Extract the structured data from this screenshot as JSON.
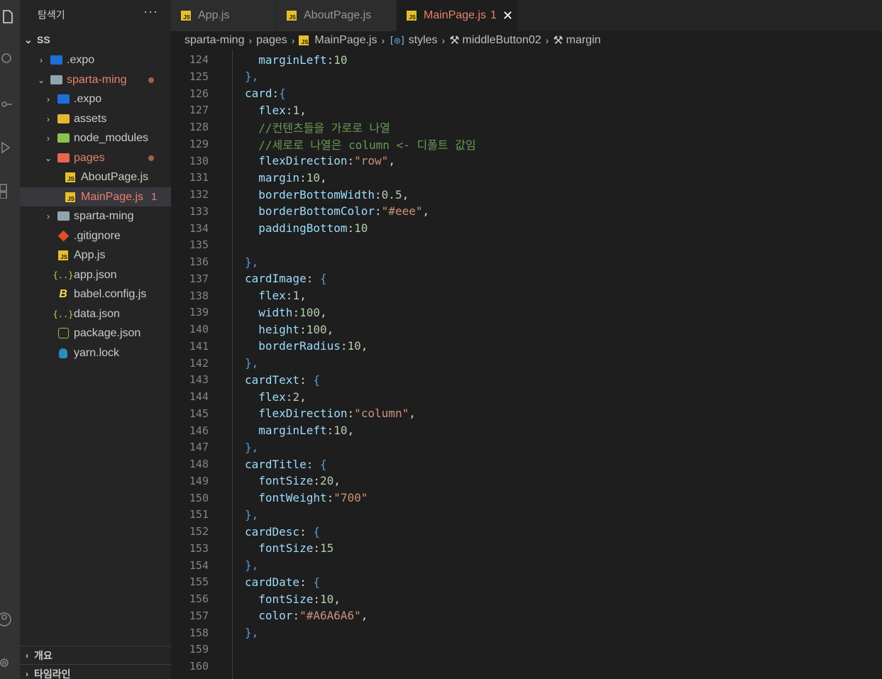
{
  "sidebar": {
    "title": "탐색기",
    "more": "···",
    "root": "SS",
    "items": [
      {
        "label": ".expo",
        "icon": "expo-folder-icon",
        "chev": "›",
        "modified": false
      },
      {
        "label": "sparta-ming",
        "icon": "open-folder-icon",
        "chev": "⌄",
        "modified": true
      },
      {
        "label": ".expo",
        "icon": "expo-folder-icon",
        "chev": "›",
        "modified": false
      },
      {
        "label": "assets",
        "icon": "assets-folder-icon",
        "chev": "›",
        "modified": false
      },
      {
        "label": "node_modules",
        "icon": "node-folder-icon",
        "chev": "›",
        "modified": false
      },
      {
        "label": "pages",
        "icon": "pages-folder-icon",
        "chev": "⌄",
        "modified": true
      },
      {
        "label": "AboutPage.js",
        "icon": "js-file-icon",
        "chev": "",
        "modified": false
      },
      {
        "label": "MainPage.js",
        "icon": "js-file-icon",
        "chev": "",
        "modified": true,
        "badge": "1"
      },
      {
        "label": "sparta-ming",
        "icon": "folder-icon",
        "chev": "›",
        "modified": false
      },
      {
        "label": ".gitignore",
        "icon": "git-icon",
        "chev": "",
        "modified": false
      },
      {
        "label": "App.js",
        "icon": "js-file-icon",
        "chev": "",
        "modified": false
      },
      {
        "label": "app.json",
        "icon": "json-file-icon",
        "chev": "",
        "modified": false
      },
      {
        "label": "babel.config.js",
        "icon": "babel-icon",
        "chev": "",
        "modified": false
      },
      {
        "label": "data.json",
        "icon": "json-file-icon",
        "chev": "",
        "modified": false
      },
      {
        "label": "package.json",
        "icon": "npm-icon",
        "chev": "",
        "modified": false
      },
      {
        "label": "yarn.lock",
        "icon": "yarn-icon",
        "chev": "",
        "modified": false
      }
    ],
    "sections": [
      "개요",
      "타임라인"
    ]
  },
  "tabs": [
    {
      "label": "App.js",
      "active": false
    },
    {
      "label": "AboutPage.js",
      "active": false
    },
    {
      "label": "MainPage.js",
      "active": true,
      "badge": "1",
      "close": "✕"
    }
  ],
  "breadcrumb": [
    "sparta-ming",
    "pages",
    "MainPage.js",
    "styles",
    "middleButton02",
    "margin"
  ],
  "editor": {
    "lines": [
      {
        "n": "124",
        "code": "  marginLeft:10"
      },
      {
        "n": "125",
        "code": "},"
      },
      {
        "n": "126",
        "code": "card:{"
      },
      {
        "n": "127",
        "code": "  flex:1,"
      },
      {
        "n": "128",
        "code": "  //컨텐츠들을 가로로 나열"
      },
      {
        "n": "129",
        "code": "  //세로로 나열은 column <- 디폴트 값임"
      },
      {
        "n": "130",
        "code": "  flexDirection:\"row\","
      },
      {
        "n": "131",
        "code": "  margin:10,"
      },
      {
        "n": "132",
        "code": "  borderBottomWidth:0.5,"
      },
      {
        "n": "133",
        "code": "  borderBottomColor:\"#eee\","
      },
      {
        "n": "134",
        "code": "  paddingBottom:10"
      },
      {
        "n": "135",
        "code": ""
      },
      {
        "n": "136",
        "code": "},"
      },
      {
        "n": "137",
        "code": "cardImage: {"
      },
      {
        "n": "138",
        "code": "  flex:1,"
      },
      {
        "n": "139",
        "code": "  width:100,"
      },
      {
        "n": "140",
        "code": "  height:100,"
      },
      {
        "n": "141",
        "code": "  borderRadius:10,"
      },
      {
        "n": "142",
        "code": "},"
      },
      {
        "n": "143",
        "code": "cardText: {"
      },
      {
        "n": "144",
        "code": "  flex:2,"
      },
      {
        "n": "145",
        "code": "  flexDirection:\"column\","
      },
      {
        "n": "146",
        "code": "  marginLeft:10,"
      },
      {
        "n": "147",
        "code": "},"
      },
      {
        "n": "148",
        "code": "cardTitle: {"
      },
      {
        "n": "149",
        "code": "  fontSize:20,"
      },
      {
        "n": "150",
        "code": "  fontWeight:\"700\""
      },
      {
        "n": "151",
        "code": "},"
      },
      {
        "n": "152",
        "code": "cardDesc: {"
      },
      {
        "n": "153",
        "code": "  fontSize:15"
      },
      {
        "n": "154",
        "code": "},"
      },
      {
        "n": "155",
        "code": "cardDate: {"
      },
      {
        "n": "156",
        "code": "  fontSize:10,"
      },
      {
        "n": "157",
        "code": "  color:\"#A6A6A6\","
      },
      {
        "n": "158",
        "code": "},"
      },
      {
        "n": "159",
        "code": ""
      },
      {
        "n": "160",
        "code": ""
      }
    ]
  },
  "colors": {
    "modified": "#e8826a",
    "key": "#9cdcfe",
    "number": "#b5cea8",
    "string": "#ce9178",
    "comment": "#6a9955"
  }
}
